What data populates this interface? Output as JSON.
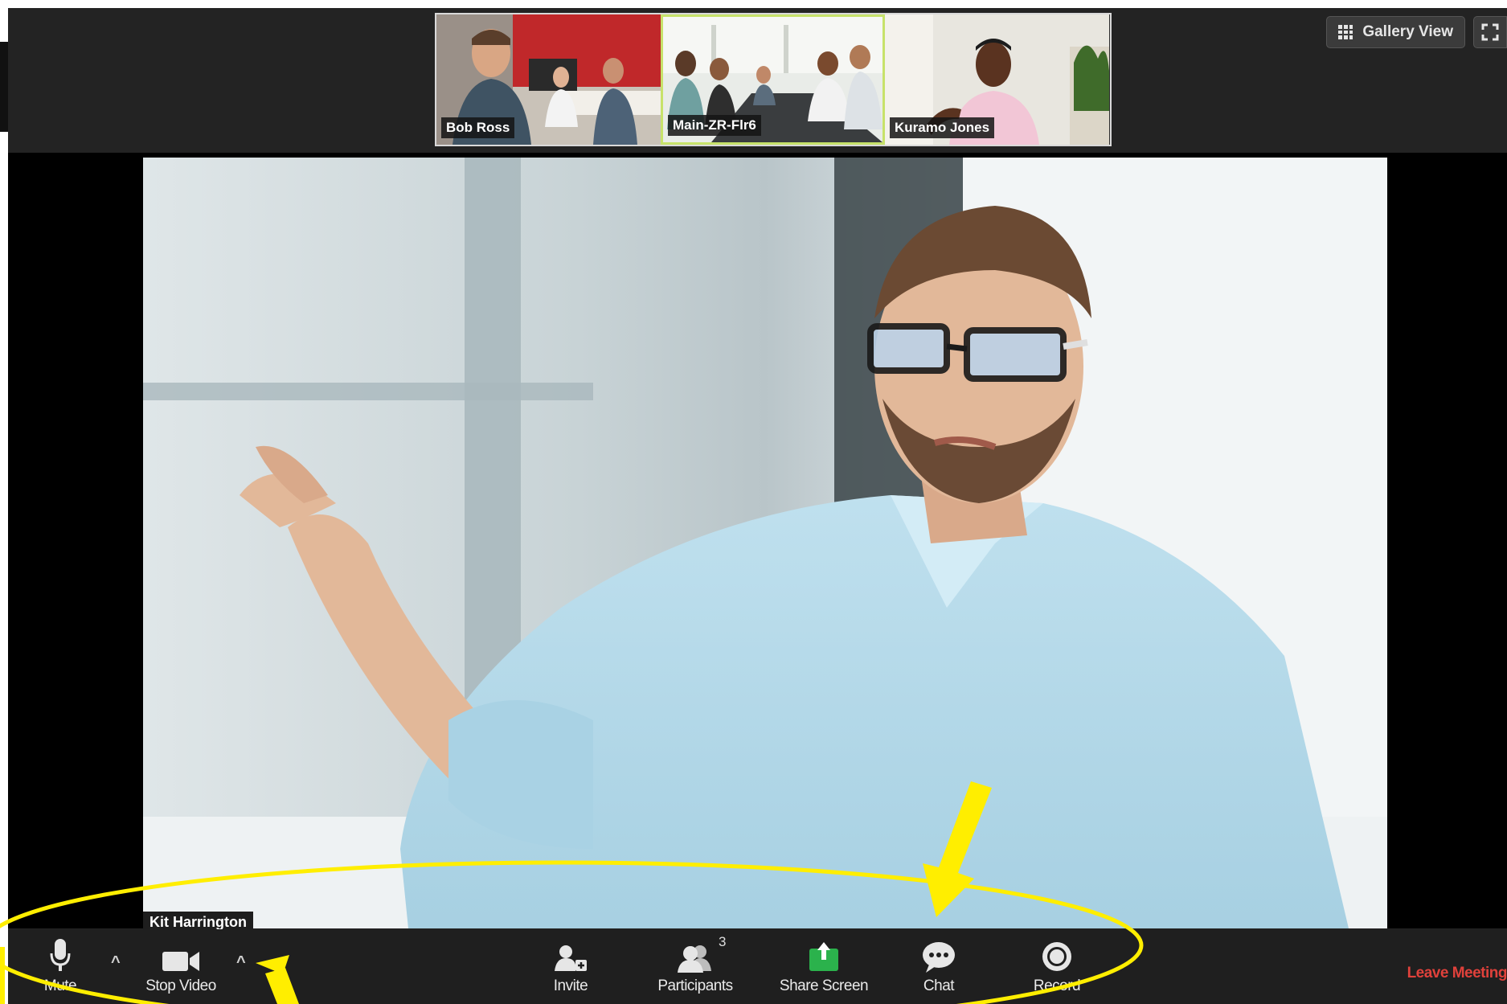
{
  "thumbnails": [
    {
      "name": "Bob Ross",
      "active": false
    },
    {
      "name": "Main-ZR-Flr6",
      "active": true
    },
    {
      "name": "Kuramo Jones",
      "active": false
    }
  ],
  "view_controls": {
    "gallery_label": "Gallery View"
  },
  "speaker": {
    "name": "Kit Harrington"
  },
  "toolbar": {
    "mute_label": "Mute",
    "stop_video_label": "Stop Video",
    "invite_label": "Invite",
    "participants_label": "Participants",
    "participants_count": "3",
    "share_screen_label": "Share Screen",
    "chat_label": "Chat",
    "record_label": "Record",
    "leave_label": "Leave Meeting",
    "caret_glyph": "^"
  },
  "colors": {
    "toolbar_bg": "#1f1f1f",
    "share_green": "#2bb24c",
    "leave_red": "#e0413b",
    "annotation_yellow": "#ffee00",
    "active_thumb_border": "#c7e26a"
  }
}
